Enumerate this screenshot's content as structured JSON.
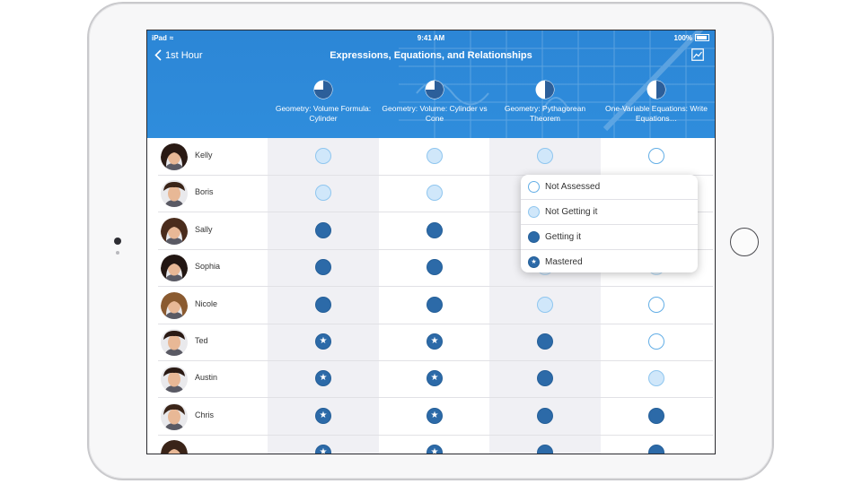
{
  "status_bar": {
    "carrier": "iPad",
    "time": "9:41 AM",
    "battery": "100%"
  },
  "nav": {
    "back_label": "1st Hour",
    "title": "Expressions, Equations, and Relationships"
  },
  "columns": [
    {
      "label": "Geometry: Volume Formula: Cylinder",
      "mastery_fraction": 0.75
    },
    {
      "label": "Geometry: Volume: Cylinder vs Cone",
      "mastery_fraction": 0.75
    },
    {
      "label": "Geometry: Pythagorean Theorem",
      "mastery_fraction": 0.5
    },
    {
      "label": "One-Variable Equations: Write Equations…",
      "mastery_fraction": 0.5
    }
  ],
  "students": [
    {
      "name": "Kelly",
      "states": [
        "not_getting_it",
        "not_getting_it",
        "not_getting_it",
        "not_assessed"
      ]
    },
    {
      "name": "Boris",
      "states": [
        "not_getting_it",
        "not_getting_it",
        "",
        ""
      ]
    },
    {
      "name": "Sally",
      "states": [
        "getting_it",
        "getting_it",
        "",
        ""
      ]
    },
    {
      "name": "Sophia",
      "states": [
        "getting_it",
        "getting_it",
        "",
        ""
      ]
    },
    {
      "name": "Nicole",
      "states": [
        "getting_it",
        "getting_it",
        "not_getting_it",
        "not_assessed"
      ]
    },
    {
      "name": "Ted",
      "states": [
        "mastered",
        "mastered",
        "getting_it",
        "not_assessed"
      ]
    },
    {
      "name": "Austin",
      "states": [
        "mastered",
        "mastered",
        "getting_it",
        "not_getting_it"
      ]
    },
    {
      "name": "Chris",
      "states": [
        "mastered",
        "mastered",
        "getting_it",
        "getting_it"
      ]
    },
    {
      "name": "",
      "states": [
        "mastered",
        "mastered",
        "getting_it",
        "getting_it"
      ]
    }
  ],
  "popover": {
    "options": [
      {
        "label": "Not Assessed",
        "state": "not_assessed"
      },
      {
        "label": "Not Getting it",
        "state": "not_getting_it"
      },
      {
        "label": "Getting it",
        "state": "getting_it"
      },
      {
        "label": "Mastered",
        "state": "mastered"
      }
    ]
  },
  "colors": {
    "header_blue": "#2f8ddc",
    "getting_it": "#2c6aa8",
    "not_getting_it": "#d0e7fa",
    "not_assessed_border": "#63aee6",
    "skin": "#e8b896",
    "hair": "#3a2a22"
  },
  "icons": {
    "back": "chevron-left-icon",
    "chart": "chart-icon",
    "wifi": "wifi-icon",
    "battery": "battery-icon",
    "star": "star-icon"
  }
}
